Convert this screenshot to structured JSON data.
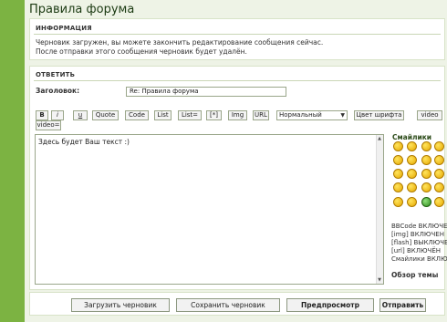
{
  "page": {
    "title": "Правила форума"
  },
  "info": {
    "heading": "ИНФОРМАЦИЯ",
    "line1": "Черновик загружен, вы можете закончить редактирование сообщения сейчас.",
    "line2": "После отправки этого сообщения черновик будет удалён."
  },
  "reply": {
    "heading": "ОТВЕТИТЬ",
    "subject_label": "Заголовок:",
    "subject_value": "Re: Правила форума",
    "message_text": "Здесь будет Ваш текст :)"
  },
  "toolbar": {
    "bold": "B",
    "italic": "i",
    "underline": "u",
    "quote": "Quote",
    "code": "Code",
    "list": "List",
    "list_ordered": "List=",
    "list_item": "[*]",
    "img": "Img",
    "url": "URL",
    "font_size": "Нормальный",
    "font_color": "Цвет шрифта",
    "video": "video",
    "video2": "video="
  },
  "smilies": {
    "title": "Смайлики",
    "icons": [
      "smile-icon",
      "wink-icon",
      "grin-icon",
      "happy-icon",
      "surprised-icon",
      "sad-icon",
      "confused-icon",
      "cool-icon",
      "laugh-icon",
      "mad-icon",
      "razz-icon",
      "evil-icon",
      "oops-icon",
      "exclaim-icon",
      "question-icon",
      "idea-icon",
      "arrow-icon",
      "neutral-icon",
      "mrgreen-icon",
      "geek-icon"
    ]
  },
  "bbcode_status": {
    "bbcode": "BBCode ВКЛЮЧЕН",
    "img": "[img] ВКЛЮЧЕН",
    "flash": "[flash] ВЫКЛЮЧЕН",
    "url": "[url] ВКЛЮЧЁН",
    "smilies": "Смайлики ВКЛЮЧЕ"
  },
  "overview": "Обзор темы",
  "buttons": {
    "load_draft": "Загрузить черновик",
    "save_draft": "Сохранить черновик",
    "preview": "Предпросмотр",
    "submit": "Отправить"
  },
  "colors": {
    "outer": "#7cb342",
    "panel": "#eef3e6",
    "title": "#1b3a12"
  }
}
